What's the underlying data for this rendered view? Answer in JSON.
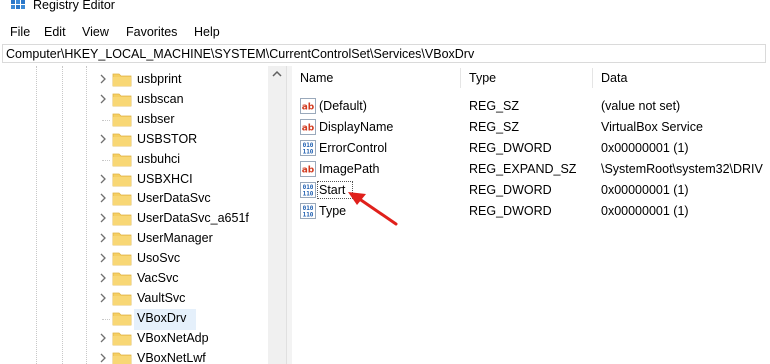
{
  "window": {
    "title": "Registry Editor",
    "app_icon": "regedit-icon"
  },
  "menu": {
    "items": [
      "File",
      "Edit",
      "View",
      "Favorites",
      "Help"
    ]
  },
  "address": {
    "path": "Computer\\HKEY_LOCAL_MACHINE\\SYSTEM\\CurrentControlSet\\Services\\VBoxDrv"
  },
  "tree": {
    "items": [
      {
        "label": "usbprint",
        "expandable": true
      },
      {
        "label": "usbscan",
        "expandable": true
      },
      {
        "label": "usbser",
        "expandable": false
      },
      {
        "label": "USBSTOR",
        "expandable": true
      },
      {
        "label": "usbuhci",
        "expandable": false
      },
      {
        "label": "USBXHCI",
        "expandable": true
      },
      {
        "label": "UserDataSvc",
        "expandable": true
      },
      {
        "label": "UserDataSvc_a651f",
        "expandable": true
      },
      {
        "label": "UserManager",
        "expandable": true
      },
      {
        "label": "UsoSvc",
        "expandable": true
      },
      {
        "label": "VacSvc",
        "expandable": true
      },
      {
        "label": "VaultSvc",
        "expandable": true
      },
      {
        "label": "VBoxDrv",
        "expandable": false,
        "selected": true
      },
      {
        "label": "VBoxNetAdp",
        "expandable": true
      },
      {
        "label": "VBoxNetLwf",
        "expandable": true
      }
    ]
  },
  "values": {
    "headers": {
      "name": "Name",
      "type": "Type",
      "data": "Data"
    },
    "rows": [
      {
        "icon": "string-value-icon",
        "name": "(Default)",
        "type": "REG_SZ",
        "data": "(value not set)"
      },
      {
        "icon": "string-value-icon",
        "name": "DisplayName",
        "type": "REG_SZ",
        "data": "VirtualBox Service"
      },
      {
        "icon": "dword-value-icon",
        "name": "ErrorControl",
        "type": "REG_DWORD",
        "data": "0x00000001 (1)"
      },
      {
        "icon": "string-value-icon",
        "name": "ImagePath",
        "type": "REG_EXPAND_SZ",
        "data": "\\SystemRoot\\system32\\DRIV"
      },
      {
        "icon": "dword-value-icon",
        "name": "Start",
        "type": "REG_DWORD",
        "data": "0x00000001 (1)",
        "focused": true
      },
      {
        "icon": "dword-value-icon",
        "name": "Type",
        "type": "REG_DWORD",
        "data": "0x00000001 (1)"
      }
    ]
  },
  "colors": {
    "accent_arrow": "#e0201b",
    "folder": "#f5cf63",
    "selection": "#e5f0fb"
  }
}
